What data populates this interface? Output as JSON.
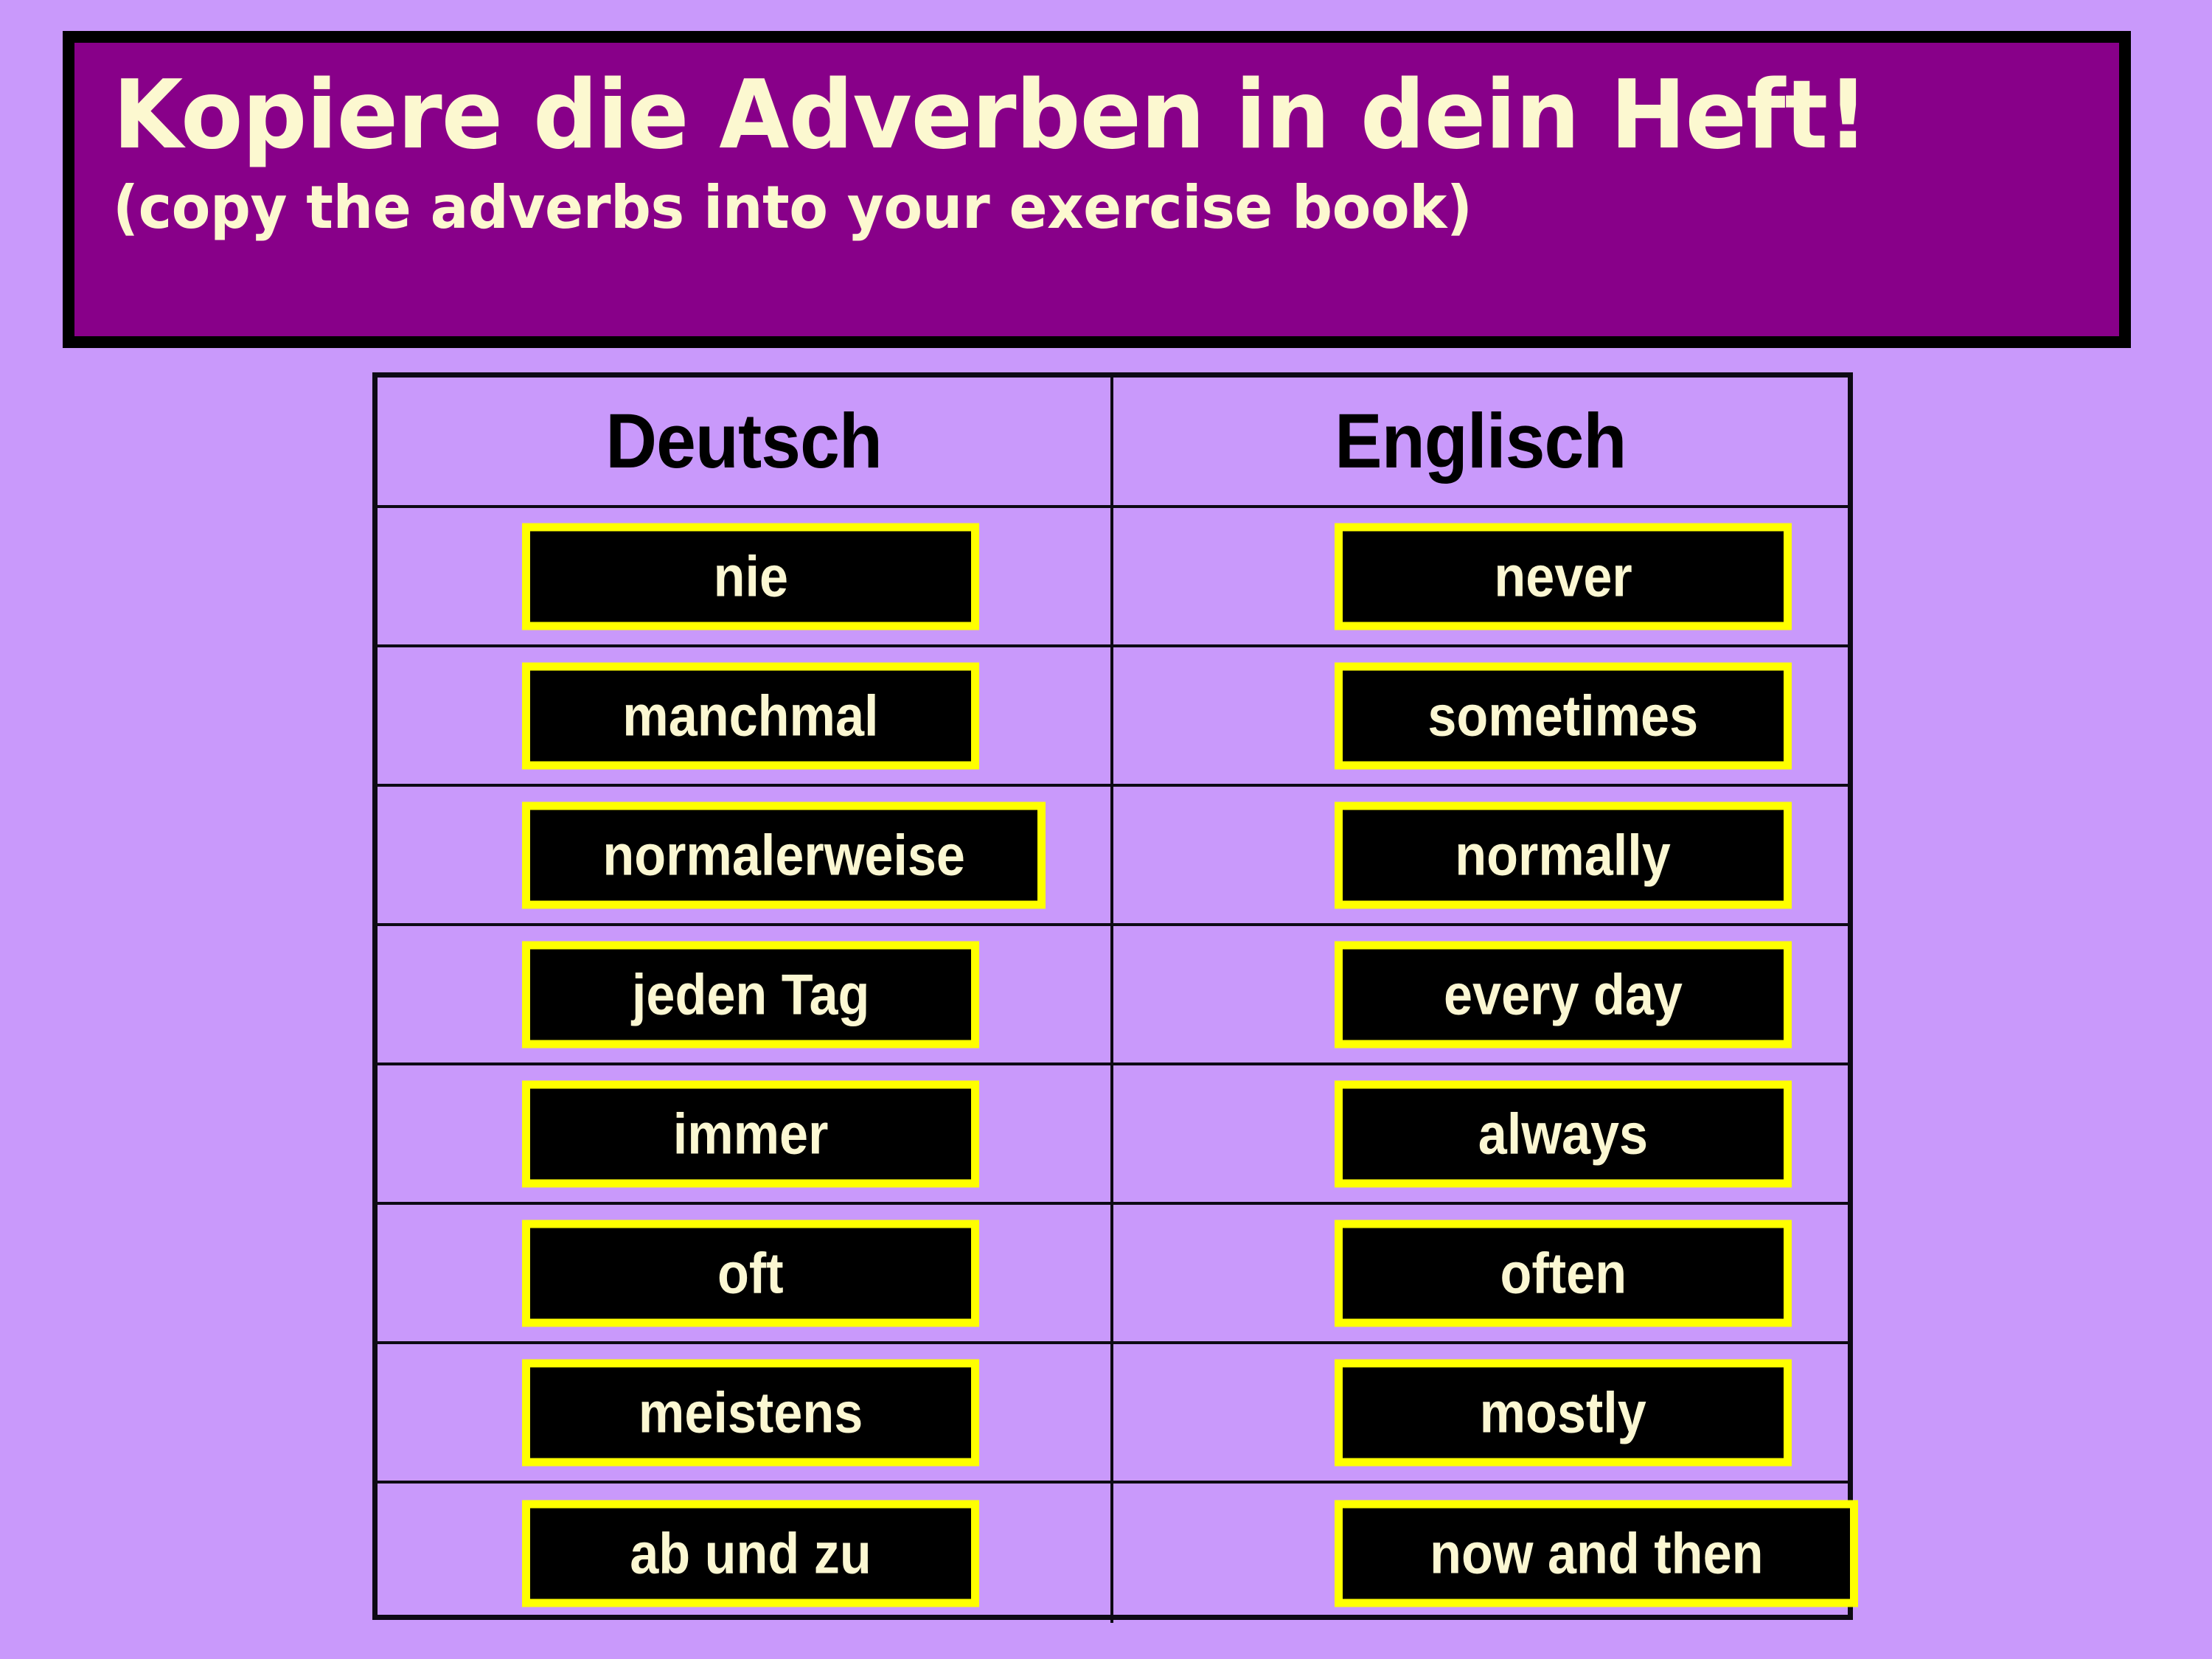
{
  "colors": {
    "background": "#c999fb",
    "banner_border": "#000000",
    "banner_fill": "#880089",
    "banner_text": "#fcf8d0",
    "chip_border": "#ffff00",
    "chip_fill": "#000000",
    "chip_text": "#fbf7d2",
    "table_border": "#0d0a14",
    "header_text": "#000000"
  },
  "banner": {
    "title": "Kopiere die Adverben in dein Heft!",
    "subtitle": "(copy the adverbs into your exercise book)"
  },
  "table": {
    "columns": [
      {
        "label": "Deutsch"
      },
      {
        "label": "Englisch"
      }
    ],
    "rows": [
      {
        "german": "nie",
        "english": "never",
        "german_wide": false,
        "english_wide": false
      },
      {
        "german": "manchmal",
        "english": "sometimes",
        "german_wide": false,
        "english_wide": false
      },
      {
        "german": "normalerweise",
        "english": "normally",
        "german_wide": true,
        "english_wide": false
      },
      {
        "german": "jeden Tag",
        "english": "every day",
        "german_wide": false,
        "english_wide": false
      },
      {
        "german": "immer",
        "english": "always",
        "german_wide": false,
        "english_wide": false
      },
      {
        "german": "oft",
        "english": "often",
        "german_wide": false,
        "english_wide": false
      },
      {
        "german": "meistens",
        "english": "mostly",
        "german_wide": false,
        "english_wide": false
      },
      {
        "german": "ab und zu",
        "english": "now and then",
        "german_wide": false,
        "english_wide": true
      }
    ]
  }
}
